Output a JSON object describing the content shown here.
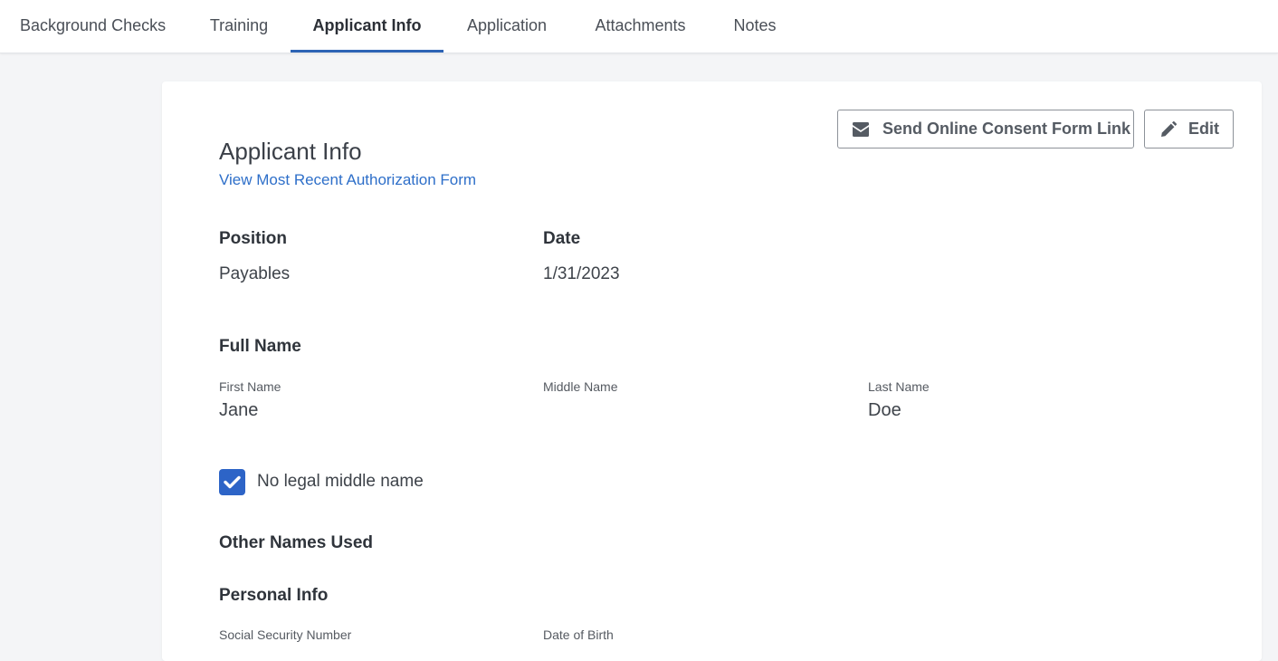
{
  "tabs": [
    {
      "label": "Background Checks",
      "active": false
    },
    {
      "label": "Training",
      "active": false
    },
    {
      "label": "Applicant Info",
      "active": true
    },
    {
      "label": "Application",
      "active": false
    },
    {
      "label": "Attachments",
      "active": false
    },
    {
      "label": "Notes",
      "active": false
    }
  ],
  "toolbar": {
    "send_consent_label": "Send Online Consent Form Link",
    "send_consent_icon": "envelope-icon",
    "edit_label": "Edit",
    "edit_icon": "pencil-icon"
  },
  "section": {
    "title": "Applicant Info",
    "auth_link": "View Most Recent Authorization Form"
  },
  "position": {
    "label": "Position",
    "value": "Payables"
  },
  "date": {
    "label": "Date",
    "value": "1/31/2023"
  },
  "full_name": {
    "heading": "Full Name",
    "first_label": "First Name",
    "first_value": "Jane",
    "middle_label": "Middle Name",
    "middle_value": "",
    "last_label": "Last Name",
    "last_value": "Doe"
  },
  "no_middle_name": {
    "label": "No legal middle name",
    "checked": true
  },
  "other_names": {
    "heading": "Other Names Used"
  },
  "personal_info": {
    "heading": "Personal Info",
    "ssn_label": "Social Security Number",
    "dob_label": "Date of Birth"
  },
  "colors": {
    "accent": "#2d64b5",
    "link": "#2e6fc9",
    "checkbox": "#2d64c7"
  }
}
